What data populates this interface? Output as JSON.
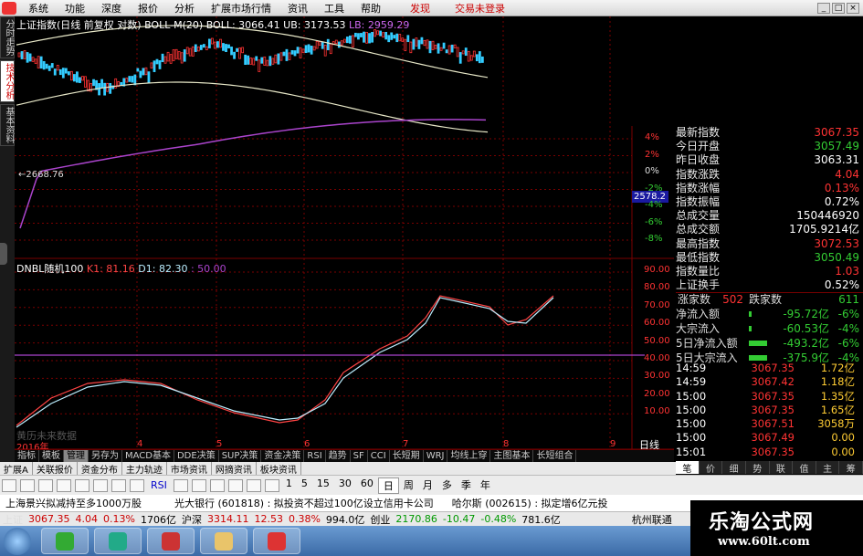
{
  "menubar": {
    "items": [
      "系统",
      "功能",
      "深度",
      "报价",
      "分析",
      "扩展市场行情",
      "资讯",
      "工具",
      "帮助"
    ],
    "highlight": "发现",
    "trade": "交易未登录"
  },
  "lefttabs": [
    "分时走势",
    "技术分析",
    "基本资料"
  ],
  "kline": {
    "title": "上证指数(日线 前复权 对数)",
    "indicator": "BOLL-M(20)",
    "boll_label": "BOLL: 3066.41",
    "ub_label": "UB: 3173.53",
    "lb_label": "LB: 2959.29",
    "low_mark": "←2668.76"
  },
  "pct_axis": [
    "4%",
    "2%",
    "0%",
    "-2%",
    "-4%",
    "-6%",
    "-8%"
  ],
  "price_box": "2578.2",
  "osc": {
    "name": "DNBL随机100",
    "k1": "K1: 81.16",
    "d1": "D1: 82.30",
    "p": ": 50.00",
    "watermark": "黄历未来数据",
    "axis": [
      "90.00",
      "80.00",
      "70.00",
      "60.00",
      "50.00",
      "40.00",
      "30.00",
      "20.00",
      "10.00"
    ]
  },
  "date_axis": {
    "labels": [
      "2016年",
      "4",
      "5",
      "6",
      "7",
      "8",
      "9"
    ],
    "unit": "日线"
  },
  "right": {
    "rows": [
      {
        "k": "最新指数",
        "v": "3067.35",
        "c": "up"
      },
      {
        "k": "今日开盘",
        "v": "3057.49",
        "c": "dn"
      },
      {
        "k": "昨日收盘",
        "v": "3063.31",
        "c": ""
      },
      {
        "k": "指数涨跌",
        "v": "4.04",
        "c": "up"
      },
      {
        "k": "指数涨幅",
        "v": "0.13%",
        "c": "up"
      },
      {
        "k": "指数振幅",
        "v": "0.72%",
        "c": ""
      },
      {
        "k": "总成交量",
        "v": "150446920",
        "c": ""
      },
      {
        "k": "总成交额",
        "v": "1705.9214亿",
        "c": ""
      },
      {
        "k": "最高指数",
        "v": "3072.53",
        "c": "up"
      },
      {
        "k": "最低指数",
        "v": "3050.49",
        "c": "dn"
      },
      {
        "k": "指数量比",
        "v": "1.03",
        "c": "up"
      },
      {
        "k": "上证换手",
        "v": "0.52%",
        "c": ""
      }
    ],
    "updown": {
      "up_label": "涨家数",
      "up": "502",
      "down_label": "跌家数",
      "down": "611"
    },
    "flow": [
      {
        "k": "净流入额",
        "v": "-95.72亿",
        "p": "-6%"
      },
      {
        "k": "大宗流入",
        "v": "-60.53亿",
        "p": "-4%"
      },
      {
        "k": "5日净流入额",
        "v": "-493.2亿",
        "p": "-6%"
      },
      {
        "k": "5日大宗流入",
        "v": "-375.9亿",
        "p": "-4%"
      }
    ],
    "ticks": [
      {
        "t": "14:59",
        "p": "3067.35",
        "v": "1.72亿"
      },
      {
        "t": "14:59",
        "p": "3067.42",
        "v": "1.18亿"
      },
      {
        "t": "15:00",
        "p": "3067.35",
        "v": "1.35亿"
      },
      {
        "t": "15:00",
        "p": "3067.35",
        "v": "1.65亿"
      },
      {
        "t": "15:00",
        "p": "3067.51",
        "v": "3058万"
      },
      {
        "t": "15:00",
        "p": "3067.49",
        "v": "0.00"
      },
      {
        "t": "15:01",
        "p": "3067.35",
        "v": "0.00"
      }
    ],
    "tabs": [
      "笔",
      "价",
      "细",
      "势",
      "联",
      "值",
      "主",
      "筹"
    ]
  },
  "bottom_tabs": [
    "指标",
    "模板",
    "管理",
    "另存为",
    "MACD基本",
    "DDE决策",
    "SUP决策",
    "资金决策",
    "RSI",
    "趋势",
    "SF",
    "CCI",
    "长短期",
    "WRJ",
    "均线上穿",
    "主图基本",
    "长短组合"
  ],
  "tabs2": [
    "扩展A",
    "关联报价",
    "资金分布",
    "主力轨迹",
    "市场资讯",
    "网摘资讯",
    "板块资讯"
  ],
  "toolbar": {
    "periods": [
      "1",
      "5",
      "15",
      "30",
      "60",
      "日",
      "周",
      "月",
      "多",
      "季",
      "年"
    ],
    "rsi": "RSI"
  },
  "news": [
    "上海景兴拟减持至多1000万股",
    "光大银行 (601818) : 拟投资不超过100亿设立信用卡公司",
    "哈尔斯 (002615) : 拟定增6亿元投"
  ],
  "status": {
    "sh_label": "上证",
    "sh_val": "3067.35",
    "sh_chg": "4.04",
    "sh_pct": "0.13%",
    "sh_vol": "1706亿",
    "sz_label": "沪深",
    "sz_val": "3314.11",
    "sz_chg": "12.53",
    "sz_pct": "0.38%",
    "sz_vol": "994.0亿",
    "cy_label": "创业",
    "cy_val": "2170.86",
    "cy_chg": "-10.47",
    "cy_pct": "-0.48%",
    "cy_vol": "781.6亿",
    "city": "杭州联通"
  },
  "watermark": {
    "t1": "乐淘公式网",
    "t2": "www.60lt.com"
  },
  "colors": {
    "up": "#ff3333",
    "down": "#33cc33",
    "boll": "#e8e8c8",
    "lb": "#aa44cc",
    "k": "#ff4444",
    "d": "#bbeeff",
    "grid": "#8b0000"
  }
}
